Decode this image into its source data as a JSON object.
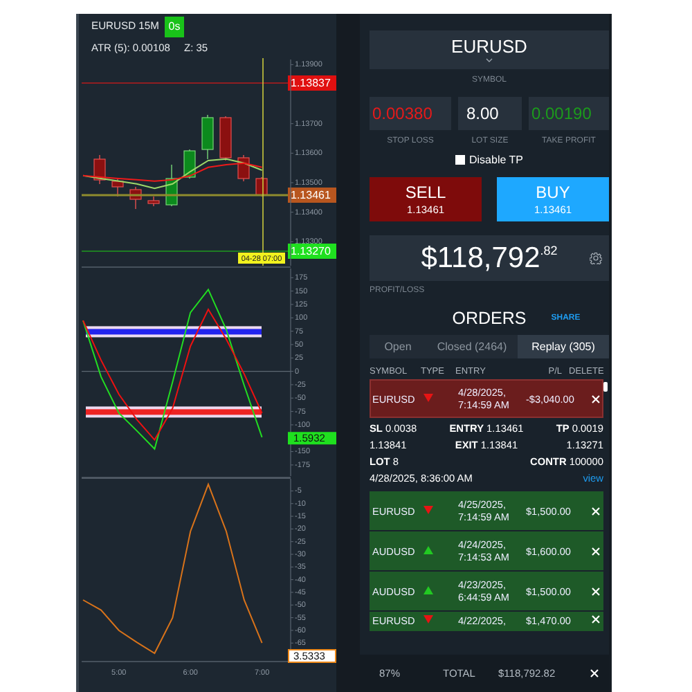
{
  "chart": {
    "title": "EURUSD 15M",
    "timer": "0s",
    "atr": "ATR (5): 0.00108",
    "z": "Z: 35",
    "price_chart": {
      "chart_data": {
        "type": "line",
        "x": [
          4.5,
          4.75,
          5,
          5.25,
          5.5,
          5.75,
          6,
          6.25,
          6.5,
          6.75,
          7
        ],
        "xlim": [
          4.48,
          7.4
        ],
        "ylim": [
          1.13214,
          1.13922
        ],
        "yticks": [
          {
            "value": 1.139,
            "label": "1.13900"
          },
          {
            "value": 1.137,
            "label": "1.13700"
          },
          {
            "value": 1.136,
            "label": "1.13600"
          },
          {
            "value": 1.135,
            "label": "1.13500"
          },
          {
            "value": 1.134,
            "label": "1.13400"
          },
          {
            "value": 1.133,
            "label": "1.13300"
          }
        ],
        "series": [
          {
            "color": "#9fd86a",
            "values": [
              1.13524,
              1.13514,
              1.13505,
              1.13496,
              1.13481,
              1.13496,
              1.13538,
              1.13575,
              1.1358,
              1.13566,
              1.13542
            ]
          },
          {
            "color": "#ee1a1a",
            "values": [
              1.13524,
              1.13519,
              1.13514,
              1.1351,
              1.13505,
              1.1351,
              1.13524,
              1.13552,
              1.13561,
              1.13566,
              1.13552
            ]
          }
        ]
      }
    },
    "price_labels": [
      {
        "kind": "stop",
        "text": "1.13837",
        "color": "#e01010"
      },
      {
        "kind": "current",
        "text": "1.13461",
        "color": "#b8561f"
      },
      {
        "kind": "target",
        "text": "1.13270",
        "color": "#1fe01f"
      }
    ],
    "cursor_time": "04-28 07:00",
    "oscillator": {
      "reading": "1.5932",
      "chart_data": {
        "type": "line",
        "x": [
          4.5,
          4.75,
          5,
          5.25,
          5.5,
          5.75,
          6,
          6.25,
          6.5,
          6.75,
          7
        ],
        "xlim": [
          4.48,
          7.4
        ],
        "ylim": [
          -198.4,
          194.8
        ],
        "yticks": [
          175,
          150,
          125,
          100,
          75,
          50,
          25,
          0,
          -25,
          -50,
          -75,
          -100,
          -150,
          -175
        ],
        "series": [
          {
            "color": "#22dd22",
            "values": [
              95,
              -10,
              -78,
              -111,
              -145,
              -20,
              110,
              153,
              78,
              -26,
              -123
            ]
          },
          {
            "color": "#ee1111",
            "values": [
              95,
              21,
              -43,
              -90,
              -128,
              -69,
              47,
              116,
              60,
              -5,
              -78
            ]
          }
        ]
      }
    },
    "indicator": {
      "reading": "3.5333",
      "chart_data": {
        "type": "line",
        "x": [
          4.5,
          4.75,
          5,
          5.25,
          5.5,
          5.75,
          6,
          6.25,
          6.5,
          6.75,
          7
        ],
        "xlim": [
          4.48,
          7.4
        ],
        "ylim": [
          -72.3,
          0.3
        ],
        "xticks": [
          {
            "value": 5,
            "label": "5:00"
          },
          {
            "value": 6,
            "label": "6:00"
          },
          {
            "value": 7,
            "label": "7:00"
          }
        ],
        "yticks": [
          -5,
          -10,
          -15,
          -20,
          -25,
          -30,
          -35,
          -40,
          -45,
          -50,
          -55,
          -60,
          -65
        ],
        "series": [
          {
            "color": "#d9731a",
            "values": [
              -48,
              -52,
              -60,
              -64.7,
              -69,
              -55,
              -21,
              -2.4,
              -21,
              -48,
              -65
            ]
          }
        ]
      }
    }
  },
  "trade": {
    "symbol": "EURUSD",
    "symbol_label": "SYMBOL",
    "fields": [
      {
        "kind": "loss",
        "value": "0.00380",
        "label": "STOP LOSS"
      },
      {
        "kind": "plain",
        "value": "8.00",
        "label": "LOT SIZE"
      },
      {
        "kind": "profit",
        "value": "0.00190",
        "label": "TAKE PROFIT"
      }
    ],
    "disable_tp": {
      "label": "Disable TP",
      "checked": false
    },
    "sell": {
      "label": "SELL",
      "price": "1.13461"
    },
    "buy": {
      "label": "BUY",
      "price": "1.13461"
    },
    "profit": "$118,792$^{.82}$",
    "profit_label": "PROFIT/LOSS"
  },
  "orders": {
    "title": "ORDERS",
    "share": "SHARE",
    "tabs": [
      {
        "label": "Open",
        "selected": false
      },
      {
        "label": "Closed (2464)",
        "selected": false
      },
      {
        "label": "Replay (305)",
        "selected": true
      }
    ],
    "columns": [
      "SYMBOL",
      "TYPE",
      "ENTRY",
      "P/L",
      "DELETE"
    ],
    "rows": [
      {
        "symbol": "EURUSD",
        "up": false,
        "entry": "4/28/2025, 7:14:59 AM",
        "pl": "-$3,040.00",
        "color": "#6b1d1d",
        "expanded": true,
        "details": {
          "sl": "**SL** 0.0038",
          "entry": "**ENTRY** 1.13461",
          "tp": "**TP** 0.0019",
          "sl_price": "1.13841",
          "exit": "**EXIT** 1.13841",
          "tp_price": "1.13271",
          "lot": "**LOT** 8",
          "contract": "**CONTR** 100000",
          "closed": "4/28/2025, 8:36:00 AM",
          "link": "view"
        }
      },
      {
        "symbol": "EURUSD",
        "up": false,
        "entry": "4/25/2025, 7:14:59 AM",
        "pl": "$1,500.00",
        "color": "#1e5a28",
        "expanded": false
      },
      {
        "symbol": "AUDUSD",
        "up": true,
        "entry": "4/24/2025, 7:14:53 AM",
        "pl": "$1,600.00",
        "color": "#1e5a28",
        "expanded": false
      },
      {
        "symbol": "AUDUSD",
        "up": true,
        "entry": "4/23/2025, 6:44:59 AM",
        "pl": "$1,500.00",
        "color": "#1e5a28",
        "expanded": false
      },
      {
        "symbol": "EURUSD",
        "up": false,
        "entry": "4/22/2025,",
        "pl": "$1,470.00",
        "color": "#1e5a28",
        "expanded": false
      }
    ]
  },
  "footer": {
    "percent": "87%",
    "total_label": "TOTAL",
    "total": "$118,792.82"
  }
}
